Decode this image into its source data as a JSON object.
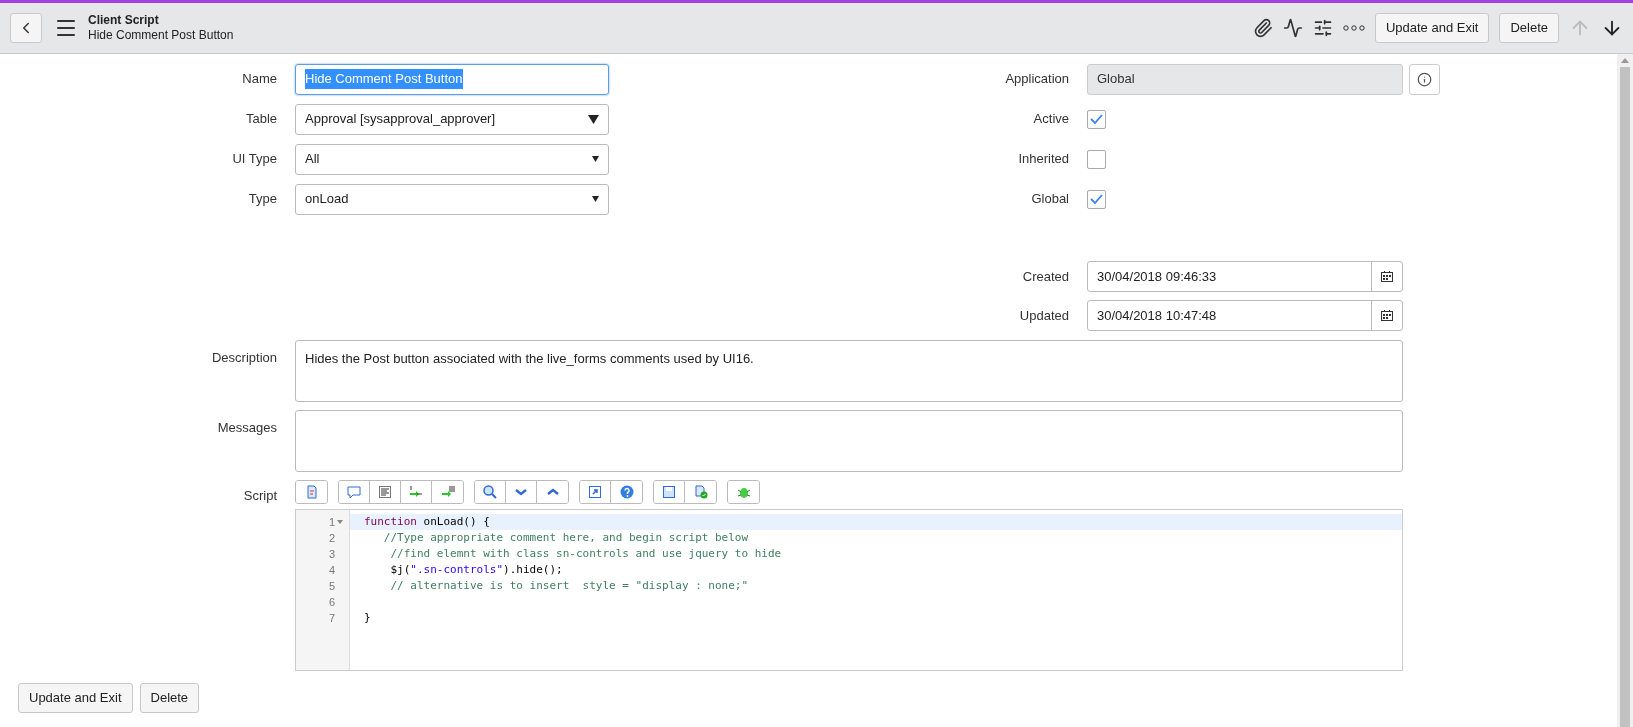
{
  "header": {
    "title": "Client Script",
    "subtitle": "Hide Comment Post Button",
    "buttons": [
      "Update and Exit",
      "Delete"
    ],
    "nav": [
      {
        "kind": "up",
        "disabled": true
      },
      {
        "kind": "down",
        "disabled": false
      }
    ]
  },
  "left_fields": [
    {
      "label": "Name",
      "kind": "text",
      "value": "Hide Comment Post Button",
      "focused": true
    },
    {
      "label": "Table",
      "kind": "reference",
      "value": "Approval [sysapproval_approver]"
    },
    {
      "label": "UI Type",
      "kind": "select",
      "value": "All"
    },
    {
      "label": "Type",
      "kind": "select",
      "value": "onLoad"
    }
  ],
  "right_fields": [
    {
      "label": "Application",
      "kind": "readonly",
      "value": "Global"
    },
    {
      "label": "Active",
      "kind": "checkbox",
      "checked": true
    },
    {
      "label": "Inherited",
      "kind": "checkbox",
      "checked": false
    },
    {
      "label": "Global",
      "kind": "checkbox",
      "checked": true
    }
  ],
  "dates": [
    {
      "label": "Created",
      "value": "30/04/2018 09:46:33"
    },
    {
      "label": "Updated",
      "value": "30/04/2018 10:47:48"
    }
  ],
  "description": {
    "label": "Description",
    "value": "Hides the Post button associated with the live_forms comments used by UI16."
  },
  "messages": {
    "label": "Messages"
  },
  "script": {
    "label": "Script",
    "lines": [
      {
        "number": "1",
        "active": true,
        "foldable": true,
        "tokens": [
          {
            "kind": "keyword",
            "text": "function"
          },
          {
            "kind": "plain",
            "text": " onLoad() {"
          }
        ]
      },
      {
        "number": "2",
        "active": false,
        "foldable": false,
        "tokens": [
          {
            "kind": "comment",
            "text": "   //Type appropriate comment here, and begin script below"
          }
        ]
      },
      {
        "number": "3",
        "active": false,
        "foldable": false,
        "tokens": [
          {
            "kind": "comment",
            "text": "    //find elemnt with class sn-controls and use jquery to hide"
          }
        ]
      },
      {
        "number": "4",
        "active": false,
        "foldable": false,
        "tokens": [
          {
            "kind": "plain",
            "text": "    $j("
          },
          {
            "kind": "string",
            "text": "\".sn-controls\""
          },
          {
            "kind": "plain",
            "text": ").hide();"
          }
        ]
      },
      {
        "number": "5",
        "active": false,
        "foldable": false,
        "tokens": [
          {
            "kind": "comment",
            "text": "    // alternative is to insert  style = \"display : none;\""
          }
        ]
      },
      {
        "number": "6",
        "active": false,
        "foldable": false
      },
      {
        "number": "7",
        "active": false,
        "foldable": false,
        "tokens": [
          {
            "kind": "plain",
            "text": "}"
          }
        ]
      }
    ]
  },
  "footer_buttons": [
    "Update and Exit",
    "Delete"
  ]
}
